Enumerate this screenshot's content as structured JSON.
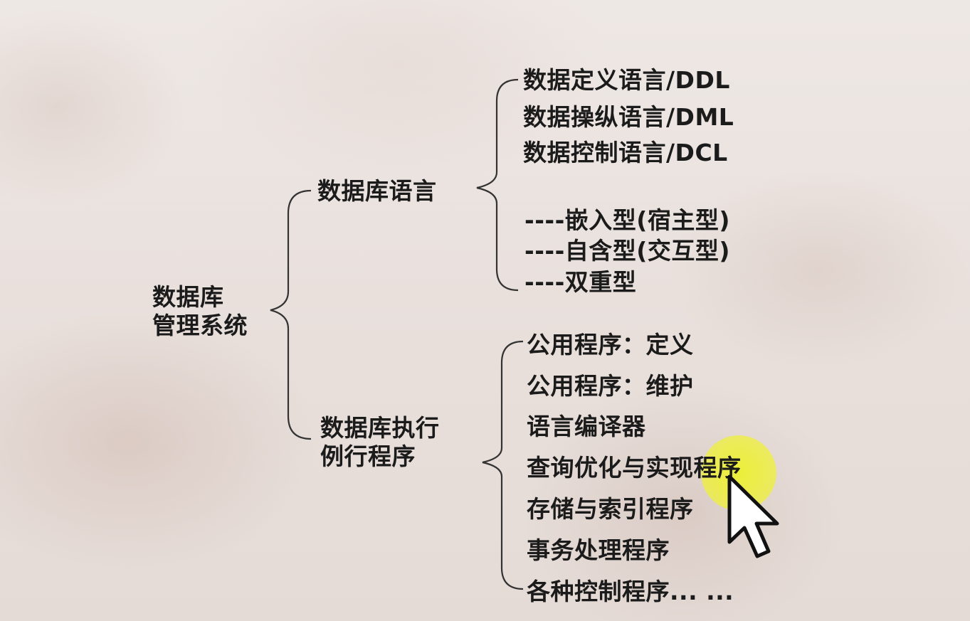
{
  "diagram": {
    "root": {
      "line1": "数据库",
      "line2": "管理系统"
    },
    "branch_language": {
      "label": "数据库语言",
      "items": [
        "数据定义语言/DDL",
        "数据操纵语言/DML",
        "数据控制语言/DCL"
      ],
      "types": [
        "----嵌入型(宿主型)",
        "----自含型(交互型)",
        "----双重型"
      ]
    },
    "branch_routines": {
      "line1": "数据库执行",
      "line2": "例行程序",
      "items": [
        "公用程序：定义",
        "公用程序：维护",
        "语言编译器",
        "查询优化与实现程序",
        "存储与索引程序",
        "事务处理程序",
        "各种控制程序... ..."
      ]
    }
  },
  "cursor": {
    "type": "arrow-pointer",
    "highlight_color": "#eef028"
  }
}
